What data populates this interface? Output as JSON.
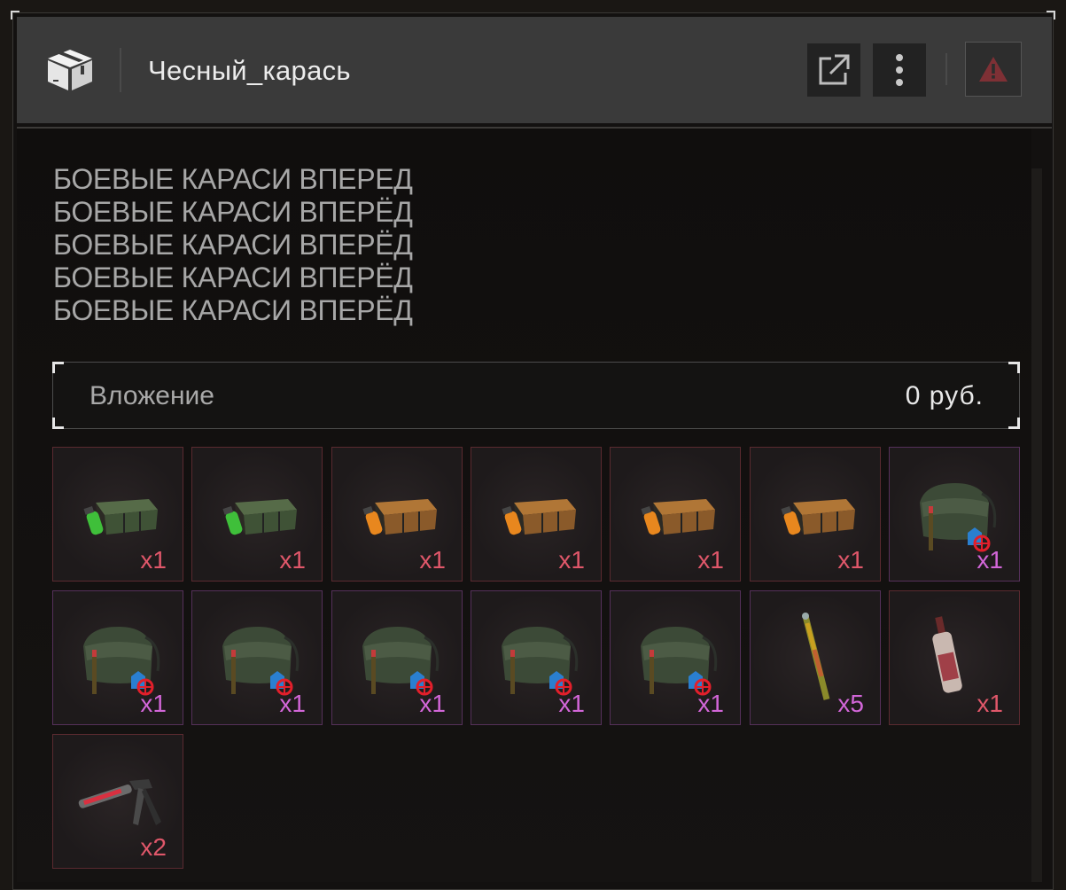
{
  "header": {
    "title": "Чесный_карась",
    "package_icon": "package-icon",
    "external_link_icon": "external-link-icon",
    "more_icon": "more-vertical-icon",
    "warning_icon": "warning-icon",
    "warning_color": "#7e3035"
  },
  "message": {
    "lines": [
      "БОЕВЫЕ КАРАСИ ВПЕРЕД",
      "БОЕВЫЕ КАРАСИ ВПЕРЁД",
      "БОЕВЫЕ КАРАСИ ВПЕРЁД",
      "БОЕВЫЕ КАРАСИ ВПЕРЁД",
      "БОЕВЫЕ КАРАСИ ВПЕРЁД"
    ]
  },
  "investment": {
    "label": "Вложение",
    "value": "0 руб."
  },
  "items": [
    {
      "name": "green-crate",
      "qty": "x1",
      "rarity": "red"
    },
    {
      "name": "green-crate",
      "qty": "x1",
      "rarity": "red"
    },
    {
      "name": "orange-crate",
      "qty": "x1",
      "rarity": "red"
    },
    {
      "name": "orange-crate",
      "qty": "x1",
      "rarity": "red"
    },
    {
      "name": "orange-crate",
      "qty": "x1",
      "rarity": "red"
    },
    {
      "name": "orange-crate",
      "qty": "x1",
      "rarity": "red"
    },
    {
      "name": "military-bag",
      "qty": "x1",
      "rarity": "purple"
    },
    {
      "name": "military-bag",
      "qty": "x1",
      "rarity": "purple"
    },
    {
      "name": "military-bag",
      "qty": "x1",
      "rarity": "purple"
    },
    {
      "name": "military-bag",
      "qty": "x1",
      "rarity": "purple"
    },
    {
      "name": "military-bag",
      "qty": "x1",
      "rarity": "purple"
    },
    {
      "name": "military-bag",
      "qty": "x1",
      "rarity": "purple"
    },
    {
      "name": "rocket-stick",
      "qty": "x5",
      "rarity": "purple"
    },
    {
      "name": "bottle",
      "qty": "x1",
      "rarity": "red"
    },
    {
      "name": "injector",
      "qty": "x2",
      "rarity": "red"
    }
  ],
  "colors": {
    "rarity_red": "#e0576a",
    "rarity_purple": "#d266d8"
  }
}
